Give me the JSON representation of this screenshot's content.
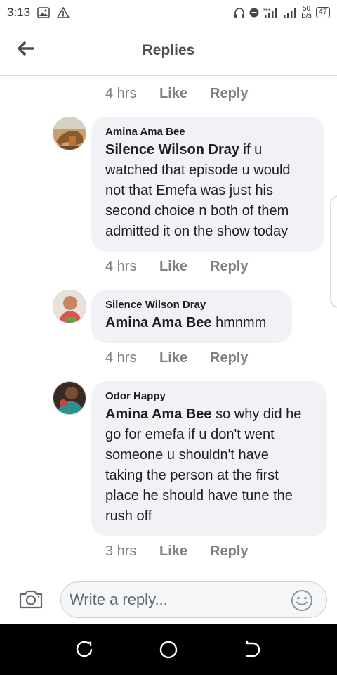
{
  "status_bar": {
    "time": "3:13",
    "speed_value": "50",
    "speed_unit": "B/s",
    "battery": "47",
    "icons": [
      "image-icon",
      "warning-icon",
      "headphones-icon",
      "minus-circle-icon",
      "signal-icon",
      "signal-icon-2"
    ]
  },
  "header": {
    "title": "Replies",
    "back_icon": "arrow-left-icon"
  },
  "top_actions": {
    "time": "4 hrs",
    "like": "Like",
    "reply": "Reply"
  },
  "comments": [
    {
      "author": "Amina Ama Bee",
      "mention": "Silence Wilson Dray",
      "lines": [
        " if u",
        "watched that episode u would",
        "not that Emefa was just his",
        "second choice n both of them",
        "admitted it on the show today"
      ],
      "time": "4 hrs",
      "like": "Like",
      "reply": "Reply"
    },
    {
      "author": "Silence Wilson Dray",
      "mention": "Amina Ama Bee",
      "lines": [
        " hmnmm"
      ],
      "time": "4 hrs",
      "like": "Like",
      "reply": "Reply"
    },
    {
      "author": "Odor Happy",
      "mention": "Amina Ama Bee",
      "lines": [
        " so why did he",
        "go for emefa if u don't went",
        "someone u shouldn't have",
        "taking the person at the first",
        "place he should have tune the",
        "rush off"
      ],
      "time": "3 hrs",
      "like": "Like",
      "reply": "Reply"
    }
  ],
  "composer": {
    "placeholder": "Write a reply...",
    "camera_icon": "camera-icon",
    "emoji_icon": "smiley-icon"
  },
  "nav_bar": {
    "icons": [
      "recent-apps-icon",
      "home-icon",
      "back-icon"
    ]
  },
  "colors": {
    "bubble": "#f0f2f5",
    "meta_text": "#7f7f7f",
    "header_text": "#4b4f56"
  }
}
